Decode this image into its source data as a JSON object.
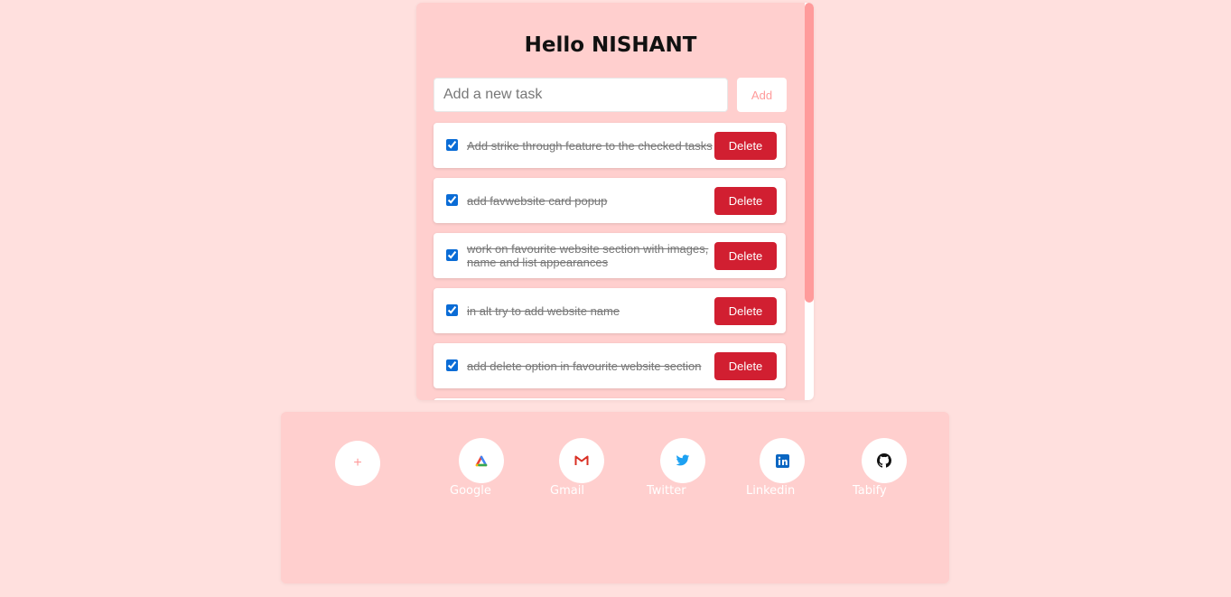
{
  "header": {
    "greeting": "Hello NISHANT"
  },
  "new_task": {
    "placeholder": "Add a new task",
    "add_label": "Add"
  },
  "tasks": [
    {
      "text": "Add strike through feature to the checked tasks",
      "checked": true,
      "delete_label": "Delete"
    },
    {
      "text": "add favwebsite card popup",
      "checked": true,
      "delete_label": "Delete"
    },
    {
      "text": "work on favourite website section with images, name and list appearances",
      "checked": true,
      "delete_label": "Delete"
    },
    {
      "text": "in alt try to add website name",
      "checked": true,
      "delete_label": "Delete"
    },
    {
      "text": "add delete option in favourite website section",
      "checked": true,
      "delete_label": "Delete"
    }
  ],
  "favourites": {
    "add_label": "+",
    "sites": [
      {
        "name": "Google",
        "icon": "google-cloud-icon"
      },
      {
        "name": "Gmail",
        "icon": "gmail-icon"
      },
      {
        "name": "Twitter",
        "icon": "twitter-icon"
      },
      {
        "name": "Linkedin",
        "icon": "linkedin-icon"
      },
      {
        "name": "Tabify",
        "icon": "github-icon"
      }
    ]
  },
  "colors": {
    "page_bg": "#ffe0de",
    "card_bg": "#ffcfce",
    "accent": "#ff9b9b",
    "delete": "#d11f31"
  }
}
